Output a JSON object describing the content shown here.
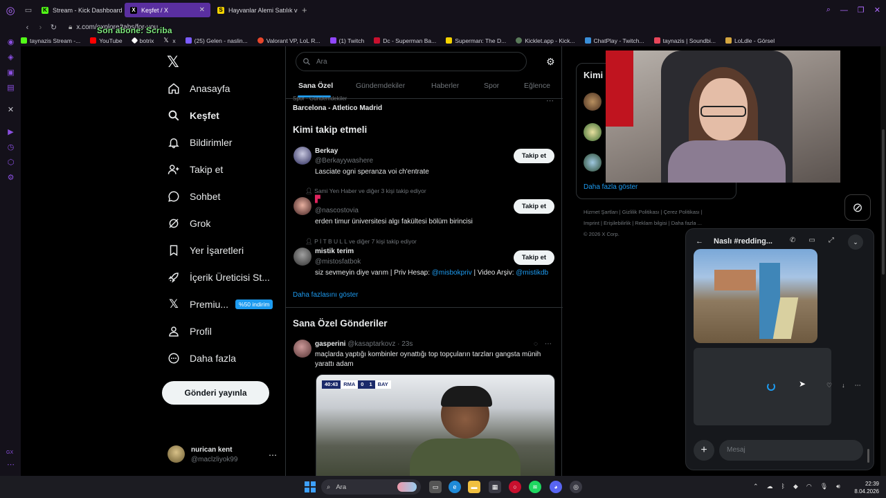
{
  "browser": {
    "tabs": [
      {
        "label": "Stream - Kick Dashboard",
        "color": "#53fc18",
        "favicon": "K"
      },
      {
        "label": "Keşfet / X",
        "color": "#ffffff",
        "favicon": "X"
      },
      {
        "label": "Hayvanlar Alemi Satılık ve",
        "color": "#f5d300",
        "favicon": "S"
      }
    ],
    "tab_close": "✕",
    "url": "x.com/explore/tabs/for-you",
    "overlay_text": "Son abone: Scriba",
    "bookmarks": [
      {
        "label": "taynazis Stream -...",
        "color": "#53fc18"
      },
      {
        "label": "YouTube",
        "color": "#ff0000"
      },
      {
        "label": "botrix",
        "color": "#ffffff"
      },
      {
        "label": "x",
        "color": "#ffffff"
      },
      {
        "label": "(25) Gelen - naslin...",
        "color": "#7b5cff"
      },
      {
        "label": "Valorant VP, LoL R...",
        "color": "#e8462b"
      },
      {
        "label": "(1) Twitch",
        "color": "#9146ff"
      },
      {
        "label": "Dc - Superman Ba...",
        "color": "#c8102e"
      },
      {
        "label": "Superman: The D...",
        "color": "#f5d300"
      },
      {
        "label": "Kicklet.app - Kick...",
        "color": "#5a7a5a"
      },
      {
        "label": "ChatPlay - Twitch...",
        "color": "#3a8fd9"
      },
      {
        "label": "taynazis | Soundbi...",
        "color": "#e8465a"
      },
      {
        "label": "LoLdle - Görsel",
        "color": "#d4a640"
      }
    ]
  },
  "x": {
    "nav": [
      {
        "label": "Anasayfa",
        "icon": "home-icon"
      },
      {
        "label": "Keşfet",
        "icon": "search-icon",
        "active": true
      },
      {
        "label": "Bildirimler",
        "icon": "bell-icon"
      },
      {
        "label": "Takip et",
        "icon": "add-user-icon"
      },
      {
        "label": "Sohbet",
        "icon": "chat-icon"
      },
      {
        "label": "Grok",
        "icon": "grok-icon"
      },
      {
        "label": "Yer İşaretleri",
        "icon": "bookmark-icon"
      },
      {
        "label": "İçerik Üreticisi St...",
        "icon": "rocket-icon"
      },
      {
        "label": "Premiu...",
        "icon": "x-icon",
        "badge": "%50 indirim"
      },
      {
        "label": "Profil",
        "icon": "user-icon"
      },
      {
        "label": "Daha fazla",
        "icon": "more-circle-icon"
      }
    ],
    "post_button": "Gönderi yayınla",
    "account": {
      "name": "nurican kent",
      "handle": "@maclzliyok99"
    },
    "search_placeholder": "Ara",
    "explore_tabs": [
      "Sana Özel",
      "Gündemdekiler",
      "Haberler",
      "Spor",
      "Eğlence"
    ],
    "trend": {
      "category": "Spor · Gündemdekiler",
      "title": "Barcelona - Atletico Madrid"
    },
    "who_to_follow": {
      "title": "Kimi takip etmeli",
      "follow_label": "Takip et",
      "show_more": "Daha fazlasını göster",
      "users": [
        {
          "context": "",
          "name": "Berkay",
          "handle": "@Berkayywashere",
          "bio": "Lasciate ogni speranza voi ch'entrate"
        },
        {
          "context": "Sami Yen Haber ve diğer 3 kişi takip ediyor",
          "name": "",
          "handle": "@nascostovia",
          "bio": "erden timur üniversitesi algı fakültesi bölüm birincisi"
        },
        {
          "context": "P İ T B U L L ve diğer 7 kişi takip ediyor",
          "name": "mistik terim",
          "handle": "@mistosfatbok",
          "bio_parts": [
            "siz sevmeyin diye varım | Priv Hesap: ",
            "@misbokpriv",
            " | Video Arşiv: ",
            "@mistikdb"
          ]
        }
      ]
    },
    "posts_title": "Sana Özel Gönderiler",
    "tweet": {
      "name": "gasperini",
      "handle": "@kasaptarkovz",
      "time": "· 23s",
      "text": "maçlarda yaptığı kombinler oynattığı top topçuların tarzları gangsta münih yarattı adam",
      "scorebug": {
        "time": "40:43",
        "home": "RMA",
        "home_score": "0",
        "away_score": "1",
        "away": "BAY"
      }
    },
    "right": {
      "who_title": "Kimi",
      "show_more": "Daha fazla göster",
      "footer": [
        "Hizmet Şartları",
        "Gizlilik Politikası",
        "Çerez Politikası",
        "Imprint",
        "Erişilebilirlik",
        "Reklam bilgisi",
        "Daha fazla ...",
        "© 2026 X Corp."
      ]
    },
    "chat": {
      "title": "Naslı #redding...",
      "message_placeholder": "Mesaj"
    }
  },
  "taskbar": {
    "search": "Ara",
    "time": "22:39",
    "date": "8.04.2026"
  },
  "colors": {
    "accent": "#1d9bf0",
    "gx_purple": "#8a4fe0",
    "active_tab": "#5a2fa0"
  }
}
